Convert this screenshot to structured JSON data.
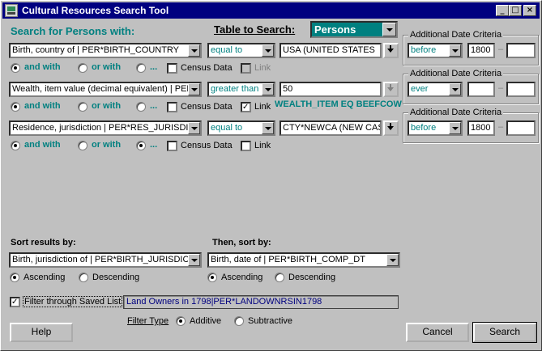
{
  "window": {
    "title": "Cultural Resources Search Tool"
  },
  "header": {
    "search_for": "Search for Persons with:",
    "table_label": "Table to Search:",
    "table_value": "Persons"
  },
  "criteria": [
    {
      "field": "Birth, country of | PER*BIRTH_COUNTRY",
      "operator": "equal to",
      "value": "USA (UNITED STATES",
      "and_with": "and with",
      "or_with": "or with",
      "more": "...",
      "census": "Census Data",
      "link": "Link",
      "link_note": ""
    },
    {
      "field": "Wealth, item value (decimal equivalent) | PER*WEALTH_VALUE",
      "operator": "greater than",
      "value": "50",
      "and_with": "and with",
      "or_with": "or with",
      "more": "...",
      "census": "Census Data",
      "link": "Link",
      "link_note": "WEALTH_ITEM EQ BEEFCOW"
    },
    {
      "field": "Residence, jurisdiction | PER*RES_JURISDICTION",
      "operator": "equal to",
      "value": "CTY*NEWCA (NEW CASTLE)",
      "and_with": "and with",
      "or_with": "or with",
      "more": "...",
      "census": "Census Data",
      "link": "Link",
      "link_note": ""
    }
  ],
  "date_criteria": [
    {
      "title": "Additional Date Criteria",
      "op": "before",
      "from": "1800",
      "sep": "–",
      "to": ""
    },
    {
      "title": "Additional Date Criteria",
      "op": "ever",
      "from": "",
      "sep": "–",
      "to": ""
    },
    {
      "title": "Additional Date Criteria",
      "op": "before",
      "from": "1800",
      "sep": "–",
      "to": ""
    }
  ],
  "sort": {
    "first_label": "Sort results by:",
    "first_field": "Birth, jurisdiction of | PER*BIRTH_JURISDICTION",
    "then_label": "Then, sort by:",
    "then_field": "Birth, date of | PER*BIRTH_COMP_DT",
    "ascending": "Ascending",
    "descending": "Descending"
  },
  "filter": {
    "label": "Filter through Saved List",
    "saved_list": "Land Owners in 1798|PER*LANDOWNRSIN1798",
    "type_label": "Filter Type",
    "additive": "Additive",
    "subtractive": "Subtractive"
  },
  "buttons": {
    "help": "Help",
    "cancel": "Cancel",
    "search": "Search"
  },
  "titlebar_buttons": {
    "minimize": "_",
    "maximize": "□",
    "close": "×"
  },
  "colors": {
    "titlebar": "#000080",
    "accent": "#008080",
    "face": "#c0c0c0"
  }
}
